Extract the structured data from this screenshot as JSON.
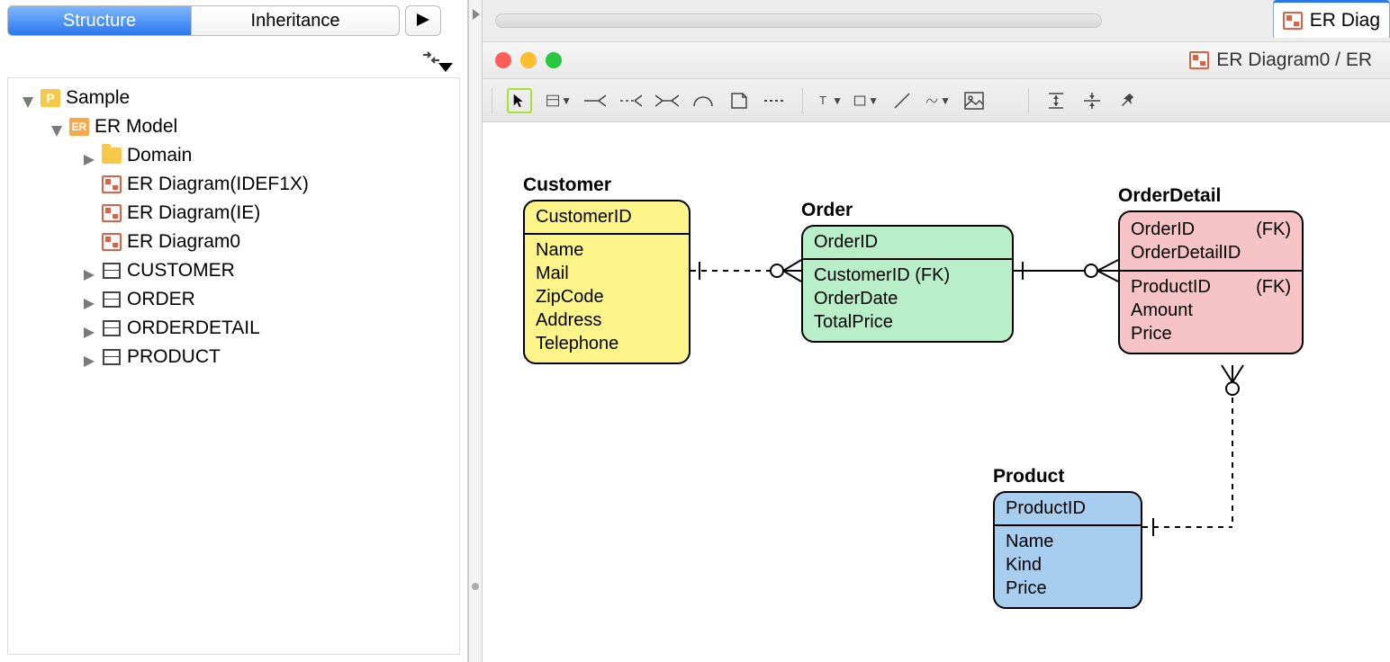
{
  "tabs": {
    "structure": "Structure",
    "inheritance": "Inheritance"
  },
  "tree": {
    "root": "Sample",
    "ermodel": "ER Model",
    "domain": "Domain",
    "diag_idef1x": "ER Diagram(IDEF1X)",
    "diag_ie": "ER Diagram(IE)",
    "diag0": "ER Diagram0",
    "t_customer": "CUSTOMER",
    "t_order": "ORDER",
    "t_orderdetail": "ORDERDETAIL",
    "t_product": "PRODUCT"
  },
  "right_tab": "ER Diag",
  "window_title": "ER Diagram0 / ER",
  "entities": {
    "customer": {
      "label": "Customer",
      "pk": "CustomerID",
      "attrs": [
        "Name",
        "Mail",
        "ZipCode",
        "Address",
        "Telephone"
      ]
    },
    "order": {
      "label": "Order",
      "pk": "OrderID",
      "attrs": [
        "CustomerID (FK)",
        "OrderDate",
        "TotalPrice"
      ]
    },
    "orderdetail": {
      "label": "OrderDetail",
      "pk1": "OrderID",
      "pk1_fk": "(FK)",
      "pk2": "OrderDetailID",
      "attr1": "ProductID",
      "attr1_fk": "(FK)",
      "attrs": [
        "Amount",
        "Price"
      ]
    },
    "product": {
      "label": "Product",
      "pk": "ProductID",
      "attrs": [
        "Name",
        "Kind",
        "Price"
      ]
    }
  }
}
